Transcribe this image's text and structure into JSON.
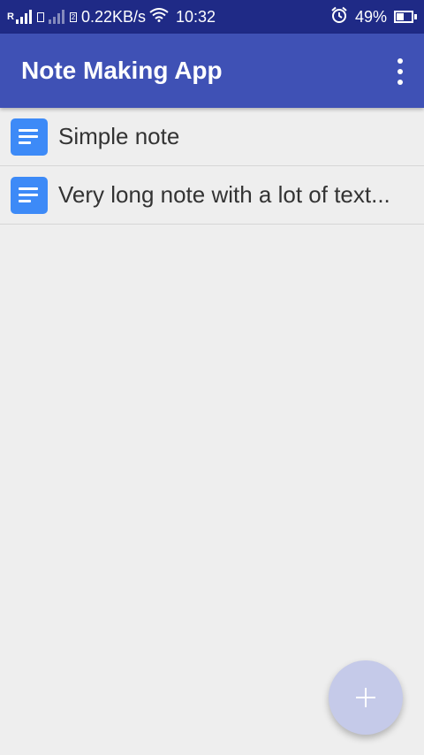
{
  "status_bar": {
    "sim1_label": "R",
    "sim2_label": "2",
    "net_speed": "0.22KB/s",
    "time": "10:32",
    "battery_pct": "49%",
    "battery_level": 0.49,
    "icons": [
      "signal-icon",
      "wifi-icon",
      "alarm-icon",
      "battery-icon"
    ]
  },
  "app_bar": {
    "title": "Note Making App",
    "menu_icon": "overflow-menu-icon"
  },
  "notes": [
    {
      "title": "Simple note",
      "icon": "note-icon"
    },
    {
      "title": "Very long note with a lot of text...",
      "icon": "note-icon"
    }
  ],
  "fab": {
    "icon": "plus-icon"
  },
  "colors": {
    "status_bar": "#1f2a86",
    "app_bar": "#3f51b5",
    "note_icon": "#3d8af7",
    "fab": "#c5cae9",
    "background": "#eeeeee"
  }
}
